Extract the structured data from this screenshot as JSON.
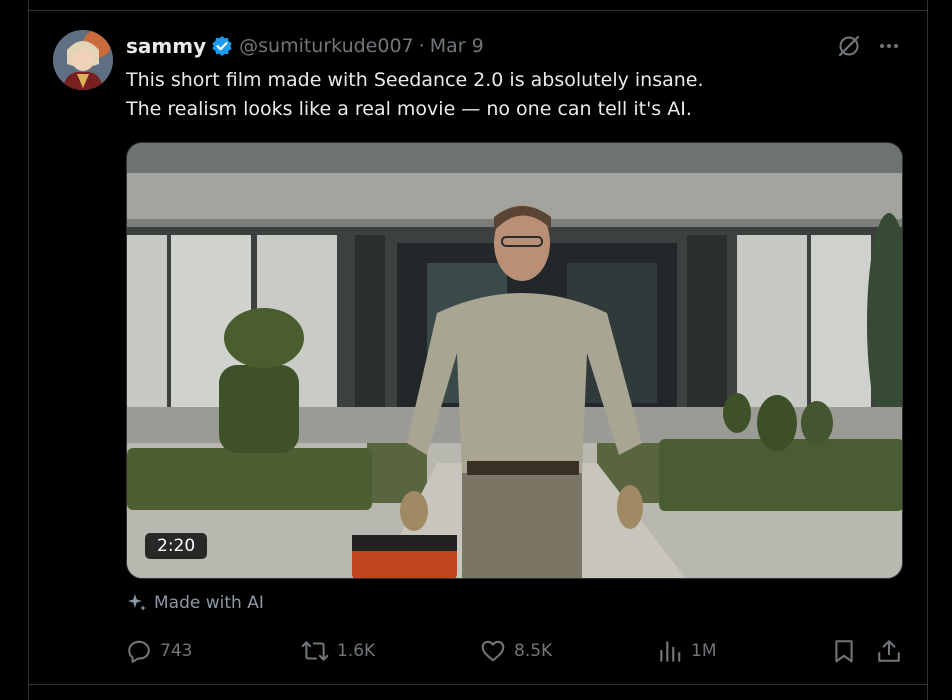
{
  "tweet": {
    "author_name": "sammy",
    "handle": "@sumiturkude007",
    "separator": "·",
    "date": "Mar 9",
    "text_lines": [
      "This short film made with Seedance 2.0 is absolutely insane.",
      "The realism looks like a real movie — no one can tell it's AI."
    ],
    "video_duration": "2:20",
    "made_with_ai_label": "Made with AI"
  },
  "actions": {
    "replies": "743",
    "reposts": "1.6K",
    "likes": "8.5K",
    "views": "1M"
  },
  "icons": {
    "verified": "verified-badge-icon",
    "grok": "grok-icon",
    "more": "more-icon",
    "sparkle": "sparkle-icon",
    "reply": "reply-icon",
    "repost": "repost-icon",
    "like": "heart-icon",
    "views": "views-icon",
    "bookmark": "bookmark-icon",
    "share": "share-icon"
  },
  "colors": {
    "background": "#000000",
    "text": "#e7e9ea",
    "secondary": "#71767b",
    "verified": "#1d9bf0"
  }
}
